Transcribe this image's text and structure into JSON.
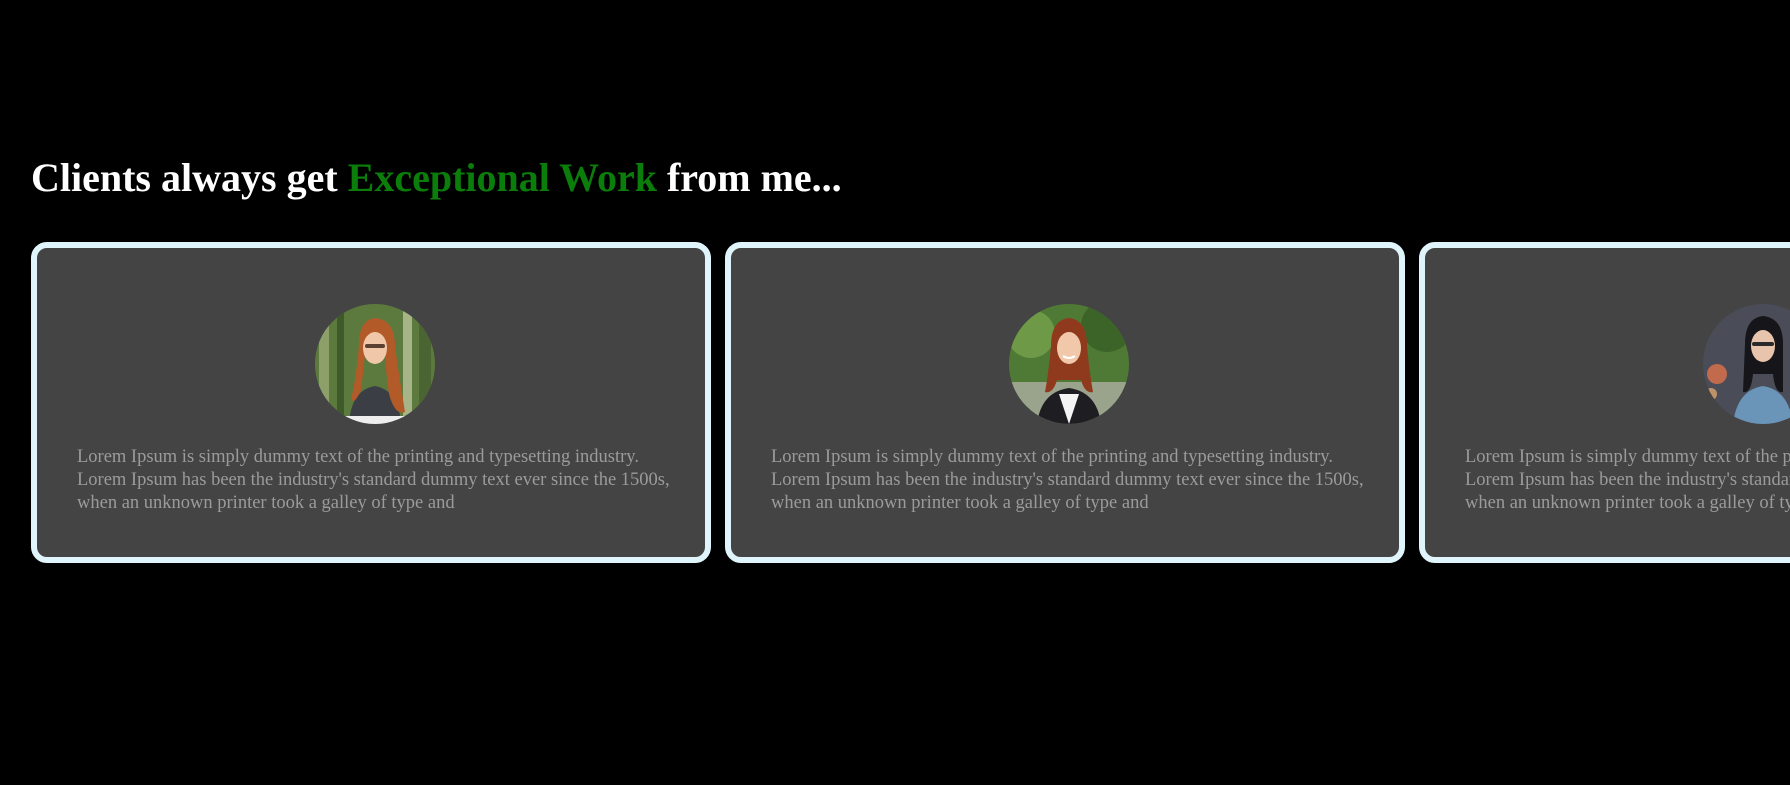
{
  "heading": {
    "prefix": "Clients always get",
    "highlight": "Exceptional Work",
    "suffix": "from me..."
  },
  "colors": {
    "background": "#000000",
    "heading_text": "#ffffff",
    "accent": "#0a7d0a",
    "card_background": "#444444",
    "card_border": "#dff4fb",
    "body_text": "#9b9b9b"
  },
  "testimonials": [
    {
      "avatar": "woman-portrait-forest",
      "text": "Lorem Ipsum is simply dummy text of the printing and typesetting industry. Lorem Ipsum has been the industry's standard dummy text ever since the 1500s, when an unknown printer took a galley of type and"
    },
    {
      "avatar": "woman-portrait-blazer",
      "text": "Lorem Ipsum is simply dummy text of the printing and typesetting industry. Lorem Ipsum has been the industry's standard dummy text ever since the 1500s, when an unknown printer took a galley of type and"
    },
    {
      "avatar": "woman-portrait-denim",
      "text": "Lorem Ipsum is simply dummy text of the printing and typesetting industry. Lorem Ipsum has been the industry's standard dummy text ever since the 1500s, when an unknown printer took a galley of type and"
    }
  ]
}
